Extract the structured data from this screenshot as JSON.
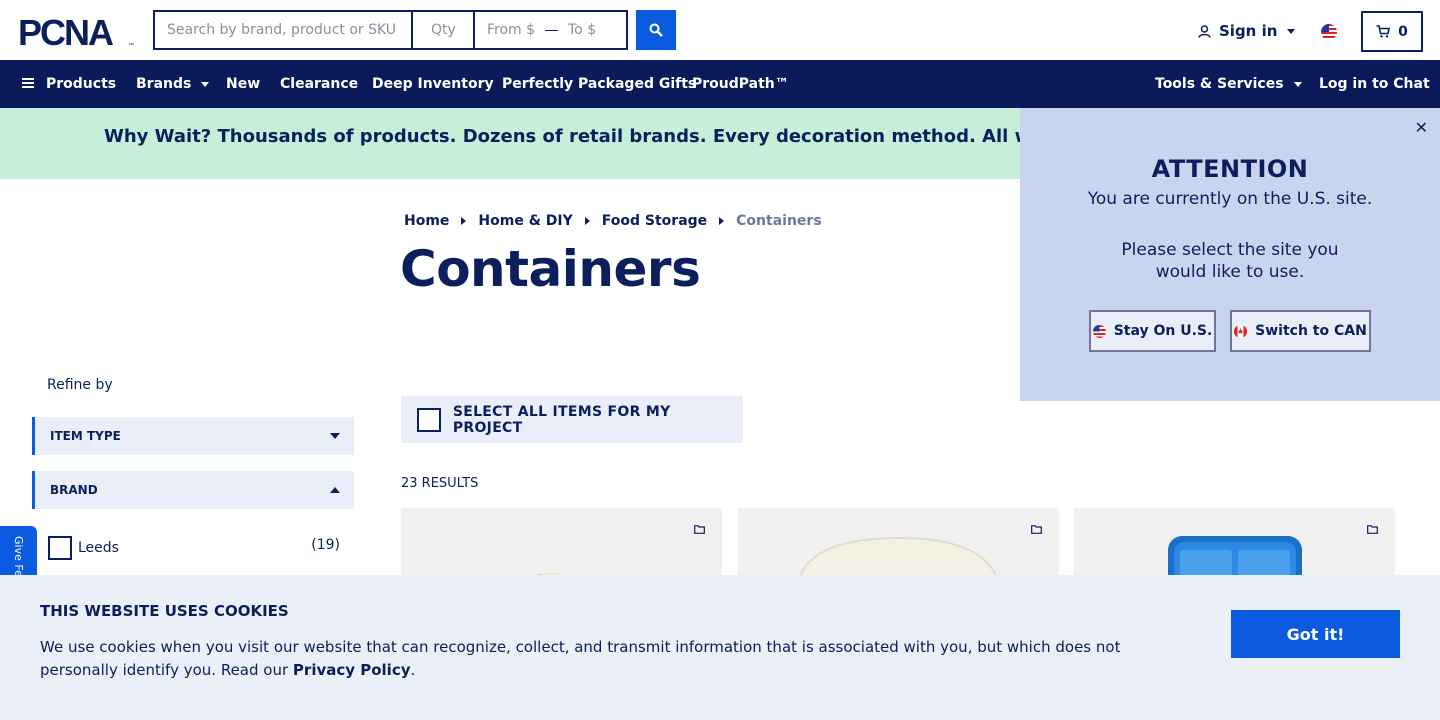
{
  "header": {
    "logo_text": "PCNA",
    "search": {
      "placeholder": "Search by brand, product or SKU"
    },
    "qty": {
      "placeholder": "Qty"
    },
    "price_from": {
      "placeholder": "From $"
    },
    "price_to": {
      "placeholder": "To $"
    },
    "sign_in_label": "Sign in",
    "cart_count": "0"
  },
  "nav": {
    "left": [
      "Products",
      "Brands",
      "New",
      "Clearance",
      "Deep Inventory",
      "Perfectly Packaged Gifts",
      "ProudPath™"
    ],
    "right": [
      "Tools & Services",
      "Log in to Chat"
    ]
  },
  "banner": {
    "text": "Why Wait? Thousands of products. Dozens of retail brands. Every decoration method. All with a standard"
  },
  "breadcrumb": [
    "Home",
    "Home & DIY",
    "Food Storage",
    "Containers"
  ],
  "page_title": "Containers",
  "sidebar": {
    "refine_label": "Refine by",
    "facets": [
      "ITEM TYPE",
      "BRAND"
    ],
    "brand_filters": [
      {
        "label": "Leeds",
        "count": "(19)"
      }
    ],
    "feedback_label": "Give Feedback"
  },
  "results": {
    "select_all_label": "SELECT ALL ITEMS FOR MY PROJECT",
    "count_label": "23 RESULTS"
  },
  "attention": {
    "title": "ATTENTION",
    "line1": "You are currently on the U.S. site.",
    "line2": "Please select the site you would like to use.",
    "stay_label": "Stay On U.S.",
    "switch_label": "Switch to CAN"
  },
  "cookie": {
    "title": "THIS WEBSITE USES COOKIES",
    "text": "We use cookies when you visit our website that can recognize, collect, and transmit information that is associated with you, but which does not personally identify you. Read our",
    "link_label": "Privacy Policy",
    "suffix": ".",
    "button_label": "Got it!"
  },
  "colors": {
    "navy": "#0a1a5a",
    "primary_blue": "#0a5be0",
    "banner_green": "#c5efd9",
    "attention_bg": "#c9d5ee",
    "cookie_bg": "#eaeff8"
  }
}
